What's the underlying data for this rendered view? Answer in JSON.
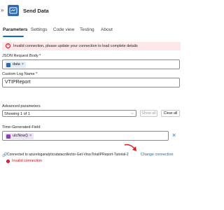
{
  "header": {
    "collapse_glyph": "»",
    "title": "Send Data",
    "app_icon": "azure-monitor-icon"
  },
  "tabs": [
    "Parameters",
    "Settings",
    "Code view",
    "Testing",
    "About"
  ],
  "active_tab": "Parameters",
  "error_banner": {
    "text": "Invalid connection, please update your connection to load complete details",
    "icon": "error-circle-icon"
  },
  "json_body": {
    "label": "JSON Request Body *",
    "token": "data",
    "token_remove": "×"
  },
  "log_name": {
    "label": "Custom Log Name *",
    "value": "VTIPReport"
  },
  "advanced": {
    "label": "Advanced parameters",
    "selected": "Showing 1 of 1",
    "show_all": "Show all",
    "clear_all": "Clear all"
  },
  "time_field": {
    "label": "Time-Generated-Field",
    "token": "utcNow()",
    "token_remove": "×",
    "clear_icon": "×"
  },
  "connection": {
    "text": "Connected to azureloganalyticsdatacollector-Get-VirusTotalIPReport-Tutorial-2",
    "change_link": "Change connection",
    "status": "Invalid connection"
  },
  "colors": {
    "accent": "#0f6cbd",
    "error": "#c50f1f",
    "error_bg": "#fde7e9",
    "annotation_arrow": "#e02020"
  }
}
